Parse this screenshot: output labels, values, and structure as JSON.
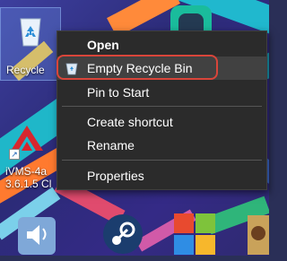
{
  "desktop": {
    "recycle_bin_label": "Recycle",
    "ivms_label_line1": "iVMS-4a",
    "ivms_label_line2": "3.6.1.5 Cl"
  },
  "context_menu": {
    "items": [
      {
        "label": "Open",
        "bold": true
      },
      {
        "label": "Empty Recycle Bin",
        "icon": "recycle-bin-icon",
        "highlighted": true
      },
      {
        "label": "Pin to Start"
      },
      {
        "label": "Create shortcut"
      },
      {
        "label": "Rename"
      },
      {
        "label": "Properties"
      }
    ]
  },
  "colors": {
    "menu_background": "#2b2b2b",
    "menu_hover": "#414141",
    "annotation_ring": "#d9453a"
  }
}
